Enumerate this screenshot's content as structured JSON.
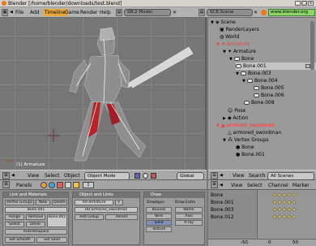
{
  "window": {
    "title": "Blender [/home/blender/downloads/test.blend]",
    "buttons": [
      "_",
      "□",
      "x"
    ]
  },
  "menubar": {
    "items": [
      "File",
      "Add",
      "Timeline",
      "Game",
      "Render",
      "Help"
    ],
    "active": "Timeline",
    "scene_selector": "SR:2-Model",
    "scene_name": "SCE:Scene",
    "url": "www.blender.org"
  },
  "viewport": {
    "corner_label": "(1) Armature",
    "header": {
      "view": "View",
      "select": "Select",
      "object": "Object",
      "mode": "Object Mode",
      "orientation": "Global"
    }
  },
  "outliner": {
    "items": [
      {
        "label": "Scene",
        "depth": 0,
        "icon": "scene-icon",
        "expanded": true
      },
      {
        "label": "RenderLayers",
        "depth": 1,
        "icon": "renderlayers-icon"
      },
      {
        "label": "World",
        "depth": 1,
        "icon": "world-icon"
      },
      {
        "label": "Armature",
        "depth": 1,
        "icon": "armature-icon",
        "expanded": true,
        "color": "#ff3a3a"
      },
      {
        "label": "Armature",
        "depth": 2,
        "icon": "armature-data-icon",
        "expanded": true
      },
      {
        "label": "Bone",
        "depth": 3,
        "icon": "bone-icon",
        "expanded": true
      },
      {
        "label": "Bone.001",
        "depth": 4,
        "icon": "bone-icon",
        "selected": true
      },
      {
        "label": "Bone.003",
        "depth": 4,
        "icon": "bone-icon",
        "expanded": true
      },
      {
        "label": "Bone.004",
        "depth": 5,
        "icon": "bone-icon",
        "expanded": true
      },
      {
        "label": "Bone.005",
        "depth": 6,
        "icon": "bone-icon"
      },
      {
        "label": "Bone.006",
        "depth": 6,
        "icon": "bone-icon"
      },
      {
        "label": "Bone.008",
        "depth": 5,
        "icon": "bone-icon"
      },
      {
        "label": "Pose",
        "depth": 2,
        "icon": "pose-icon"
      },
      {
        "label": "Action",
        "depth": 2,
        "icon": "action-icon"
      },
      {
        "label": "armored_swordman",
        "depth": 1,
        "icon": "mesh-icon",
        "expanded": true
      },
      {
        "label": "armored_swordman",
        "depth": 2,
        "icon": "mesh-data-icon"
      },
      {
        "label": "Vertex Groups",
        "depth": 2,
        "icon": "vertex-groups-icon",
        "expanded": true
      },
      {
        "label": "Bone",
        "depth": 3,
        "icon": "group-dot-icon"
      },
      {
        "label": "Bone.001",
        "depth": 3,
        "icon": "group-dot-icon"
      }
    ],
    "header": {
      "view": "View",
      "search": "Search",
      "scenes": "All Scenes"
    }
  },
  "buttons_window": {
    "header": {
      "panels": "Panels"
    },
    "panel_titles": [
      "Link and Materials",
      "Object and Links",
      "Draw"
    ],
    "panel1_buttons": [
      "Vertex Groups",
      "New",
      "Delete",
      "Assign",
      "Remove",
      "Select",
      "Desel.",
      "Bone.001",
      "AutoTexSpace",
      "Set Smooth",
      "Set Solid"
    ],
    "panel2_buttons": [
      "AR:Armature",
      "F",
      "OB:armored_swordman",
      "Add Group",
      "Parent"
    ],
    "panel3_buttons": [
      "Drawtype",
      "Draw Extra",
      "Bounds",
      "Wire",
      "Name",
      "Axis",
      "Solid",
      "Texture",
      "X-ray"
    ],
    "frame": "1",
    "bone_field": "Bone.001"
  },
  "action_editor": {
    "rows": [
      "Bone",
      "Bone.001",
      "Bone.003",
      "Bone.012"
    ],
    "header": {
      "view": "View",
      "select": "Select",
      "channel": "Channel",
      "marker": "Marker"
    },
    "ruler": [
      "-50",
      "0",
      "50"
    ],
    "keyframe_columns": 5
  }
}
